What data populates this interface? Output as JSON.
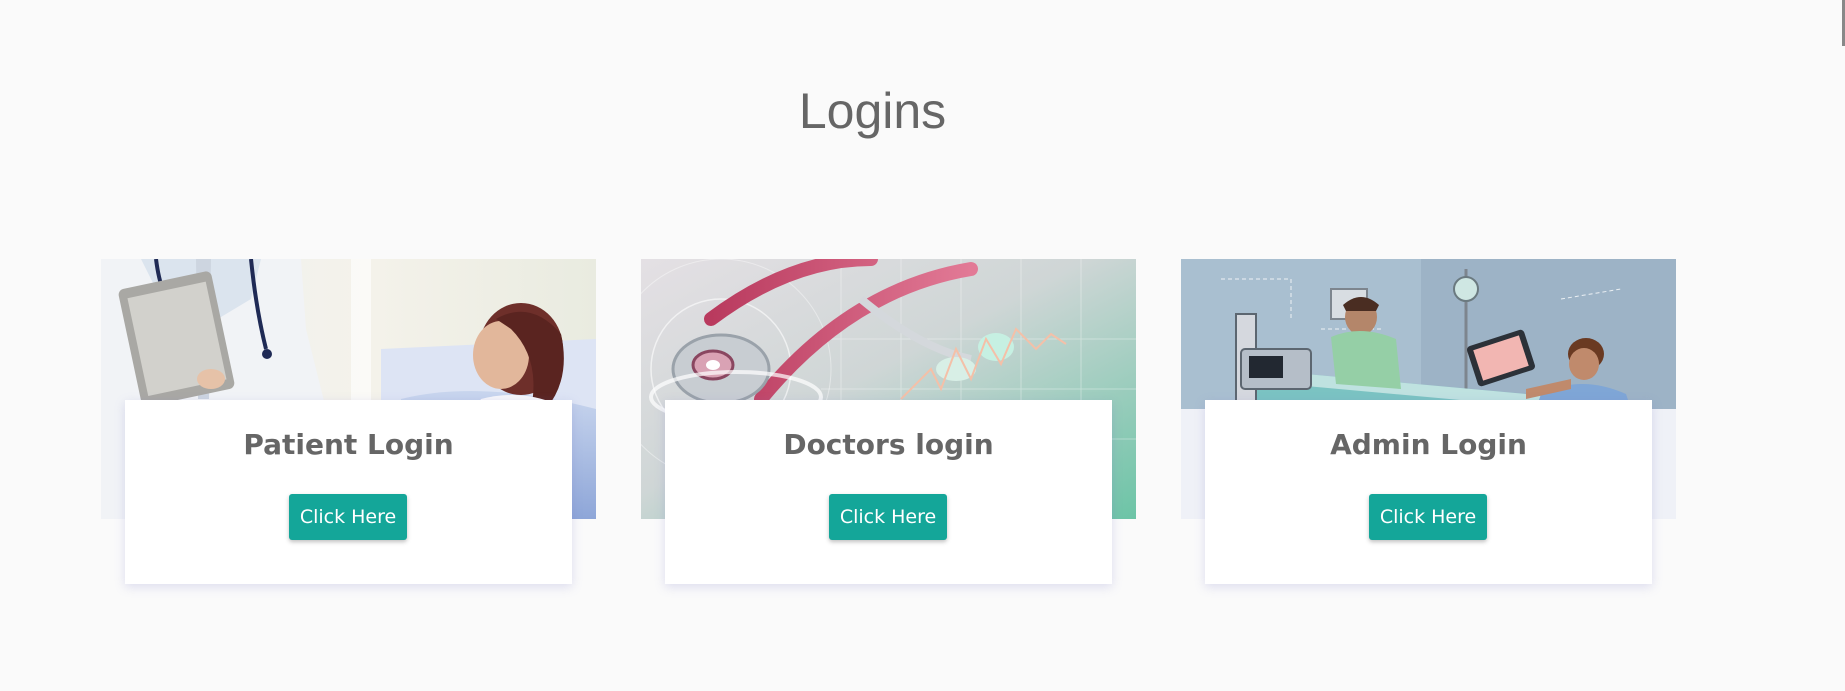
{
  "page": {
    "title": "Logins"
  },
  "cards": [
    {
      "image": "doctor-with-patient-photo",
      "title": "Patient Login",
      "button_label": "Click Here"
    },
    {
      "image": "stethoscope-photo",
      "title": "Doctors login",
      "button_label": "Click Here"
    },
    {
      "image": "hospital-bed-illustration",
      "title": "Admin Login",
      "button_label": "Click Here"
    }
  ],
  "colors": {
    "background": "#fafafa",
    "accent": "#14a699",
    "text": "#666666"
  }
}
